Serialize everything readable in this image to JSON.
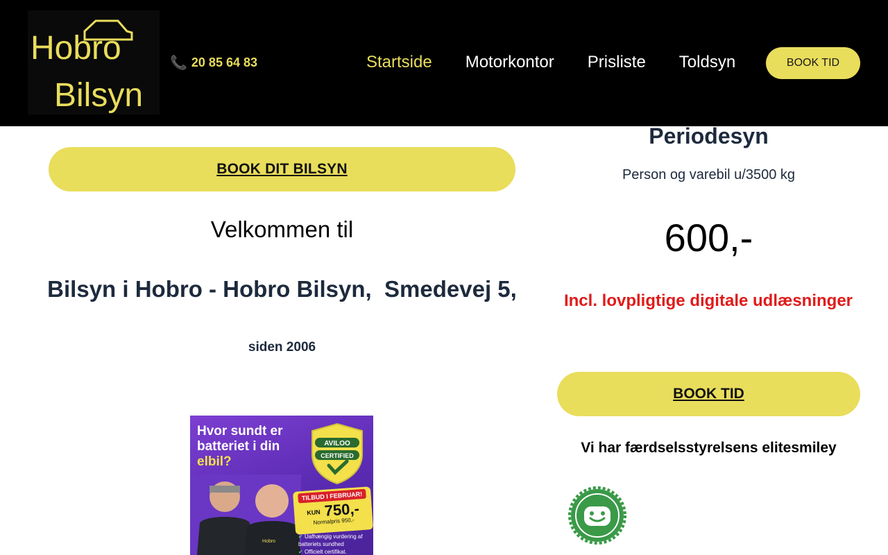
{
  "header": {
    "logo": {
      "line1": "Hobro",
      "line2": "Bilsyn"
    },
    "phone": {
      "icon": "phone-icon",
      "number": "20 85 64 83"
    },
    "nav": [
      {
        "label": "Startside",
        "active": true
      },
      {
        "label": "Motorkontor",
        "active": false
      },
      {
        "label": "Prisliste",
        "active": false
      },
      {
        "label": "Toldsyn",
        "active": false
      }
    ],
    "book_button": "BOOK TID"
  },
  "main": {
    "book_button": "BOOK DIT BILSYN",
    "welcome": "Velkommen til",
    "headline": "Bilsyn i Hobro - Hobro Bilsyn,  Smedevej 5,",
    "since": "siden 2006",
    "promo": {
      "title_part1": "Hvor sundt er batteriet i din ",
      "title_highlight": "elbil?",
      "badge_line1": "AVILOO",
      "badge_line2": "CERTIFIED",
      "offer_tag": "TILBUD I FEBRUAR!",
      "offer_kun": "KUN",
      "offer_price": "750,-",
      "offer_normal": "Normalpris 950,-",
      "bullets": [
        "Uafhængig vurdering af batteriets sundhed",
        "Officielt certifikat."
      ]
    }
  },
  "sidebar": {
    "title": "Periodesyn",
    "subtitle": "Person og varebil u/3500 kg",
    "price": "600,-",
    "incl": "Incl. lovpligtige digitale udlæsninger",
    "book_button": "BOOK TID",
    "elite": "Vi har færdselsstyrelsens elitesmiley"
  },
  "colors": {
    "accent": "#e9dd5c",
    "header_bg": "#000000",
    "heading": "#1d2a3d",
    "alert": "#e01b1b",
    "smiley_green": "#3a9a48"
  }
}
